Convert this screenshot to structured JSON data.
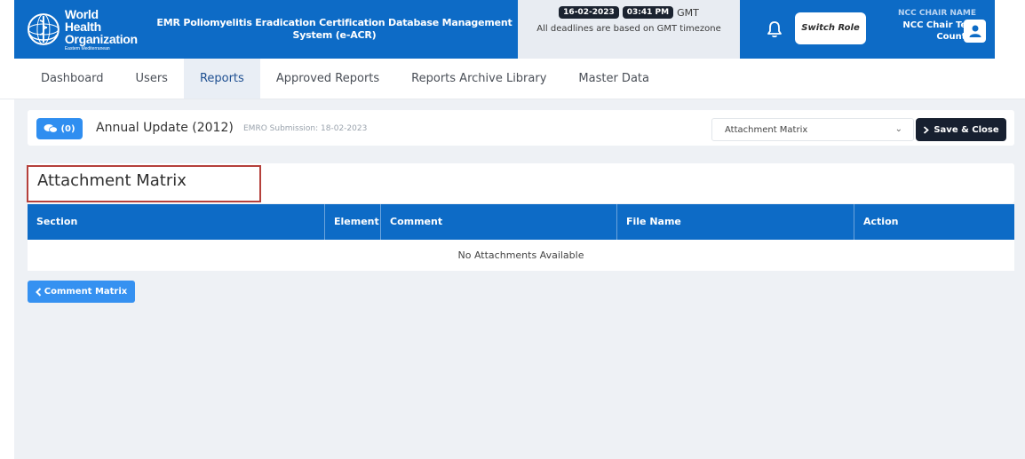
{
  "header": {
    "org_line1": "World Health",
    "org_line2": "Organization",
    "org_region": "Eastern Mediterranean",
    "app_title": "EMR Poliomyelitis Eradication Certification Database Management System (e-ACR)",
    "date": "16-02-2023",
    "time": "03:41 PM",
    "timezone": "GMT",
    "deadline_note": "All deadlines are based on GMT timezone",
    "switch_role_label": "Switch Role",
    "user_role_heading": "NCC CHAIR NAME",
    "user_name": "NCC Chair Test",
    "user_country": "Country",
    "accent_color": "#0d6bc6"
  },
  "nav": {
    "items": [
      {
        "label": "Dashboard"
      },
      {
        "label": "Users"
      },
      {
        "label": "Reports"
      },
      {
        "label": "Approved Reports"
      },
      {
        "label": "Reports Archive Library"
      },
      {
        "label": "Master Data"
      }
    ],
    "active": "Reports"
  },
  "report_bar": {
    "comment_count": "(0)",
    "report_title": "Annual Update (2012)",
    "submission": "EMRO Submission: 18-02-2023",
    "selected_view": "Attachment Matrix",
    "save_label": "Save & Close"
  },
  "attachment_panel": {
    "title": "Attachment Matrix"
  },
  "table": {
    "columns": [
      "Section",
      "Element",
      "Comment",
      "File Name",
      "Action"
    ],
    "empty_message": "No Attachments Available"
  },
  "footer_nav": {
    "back_label": "Comment Matrix"
  }
}
